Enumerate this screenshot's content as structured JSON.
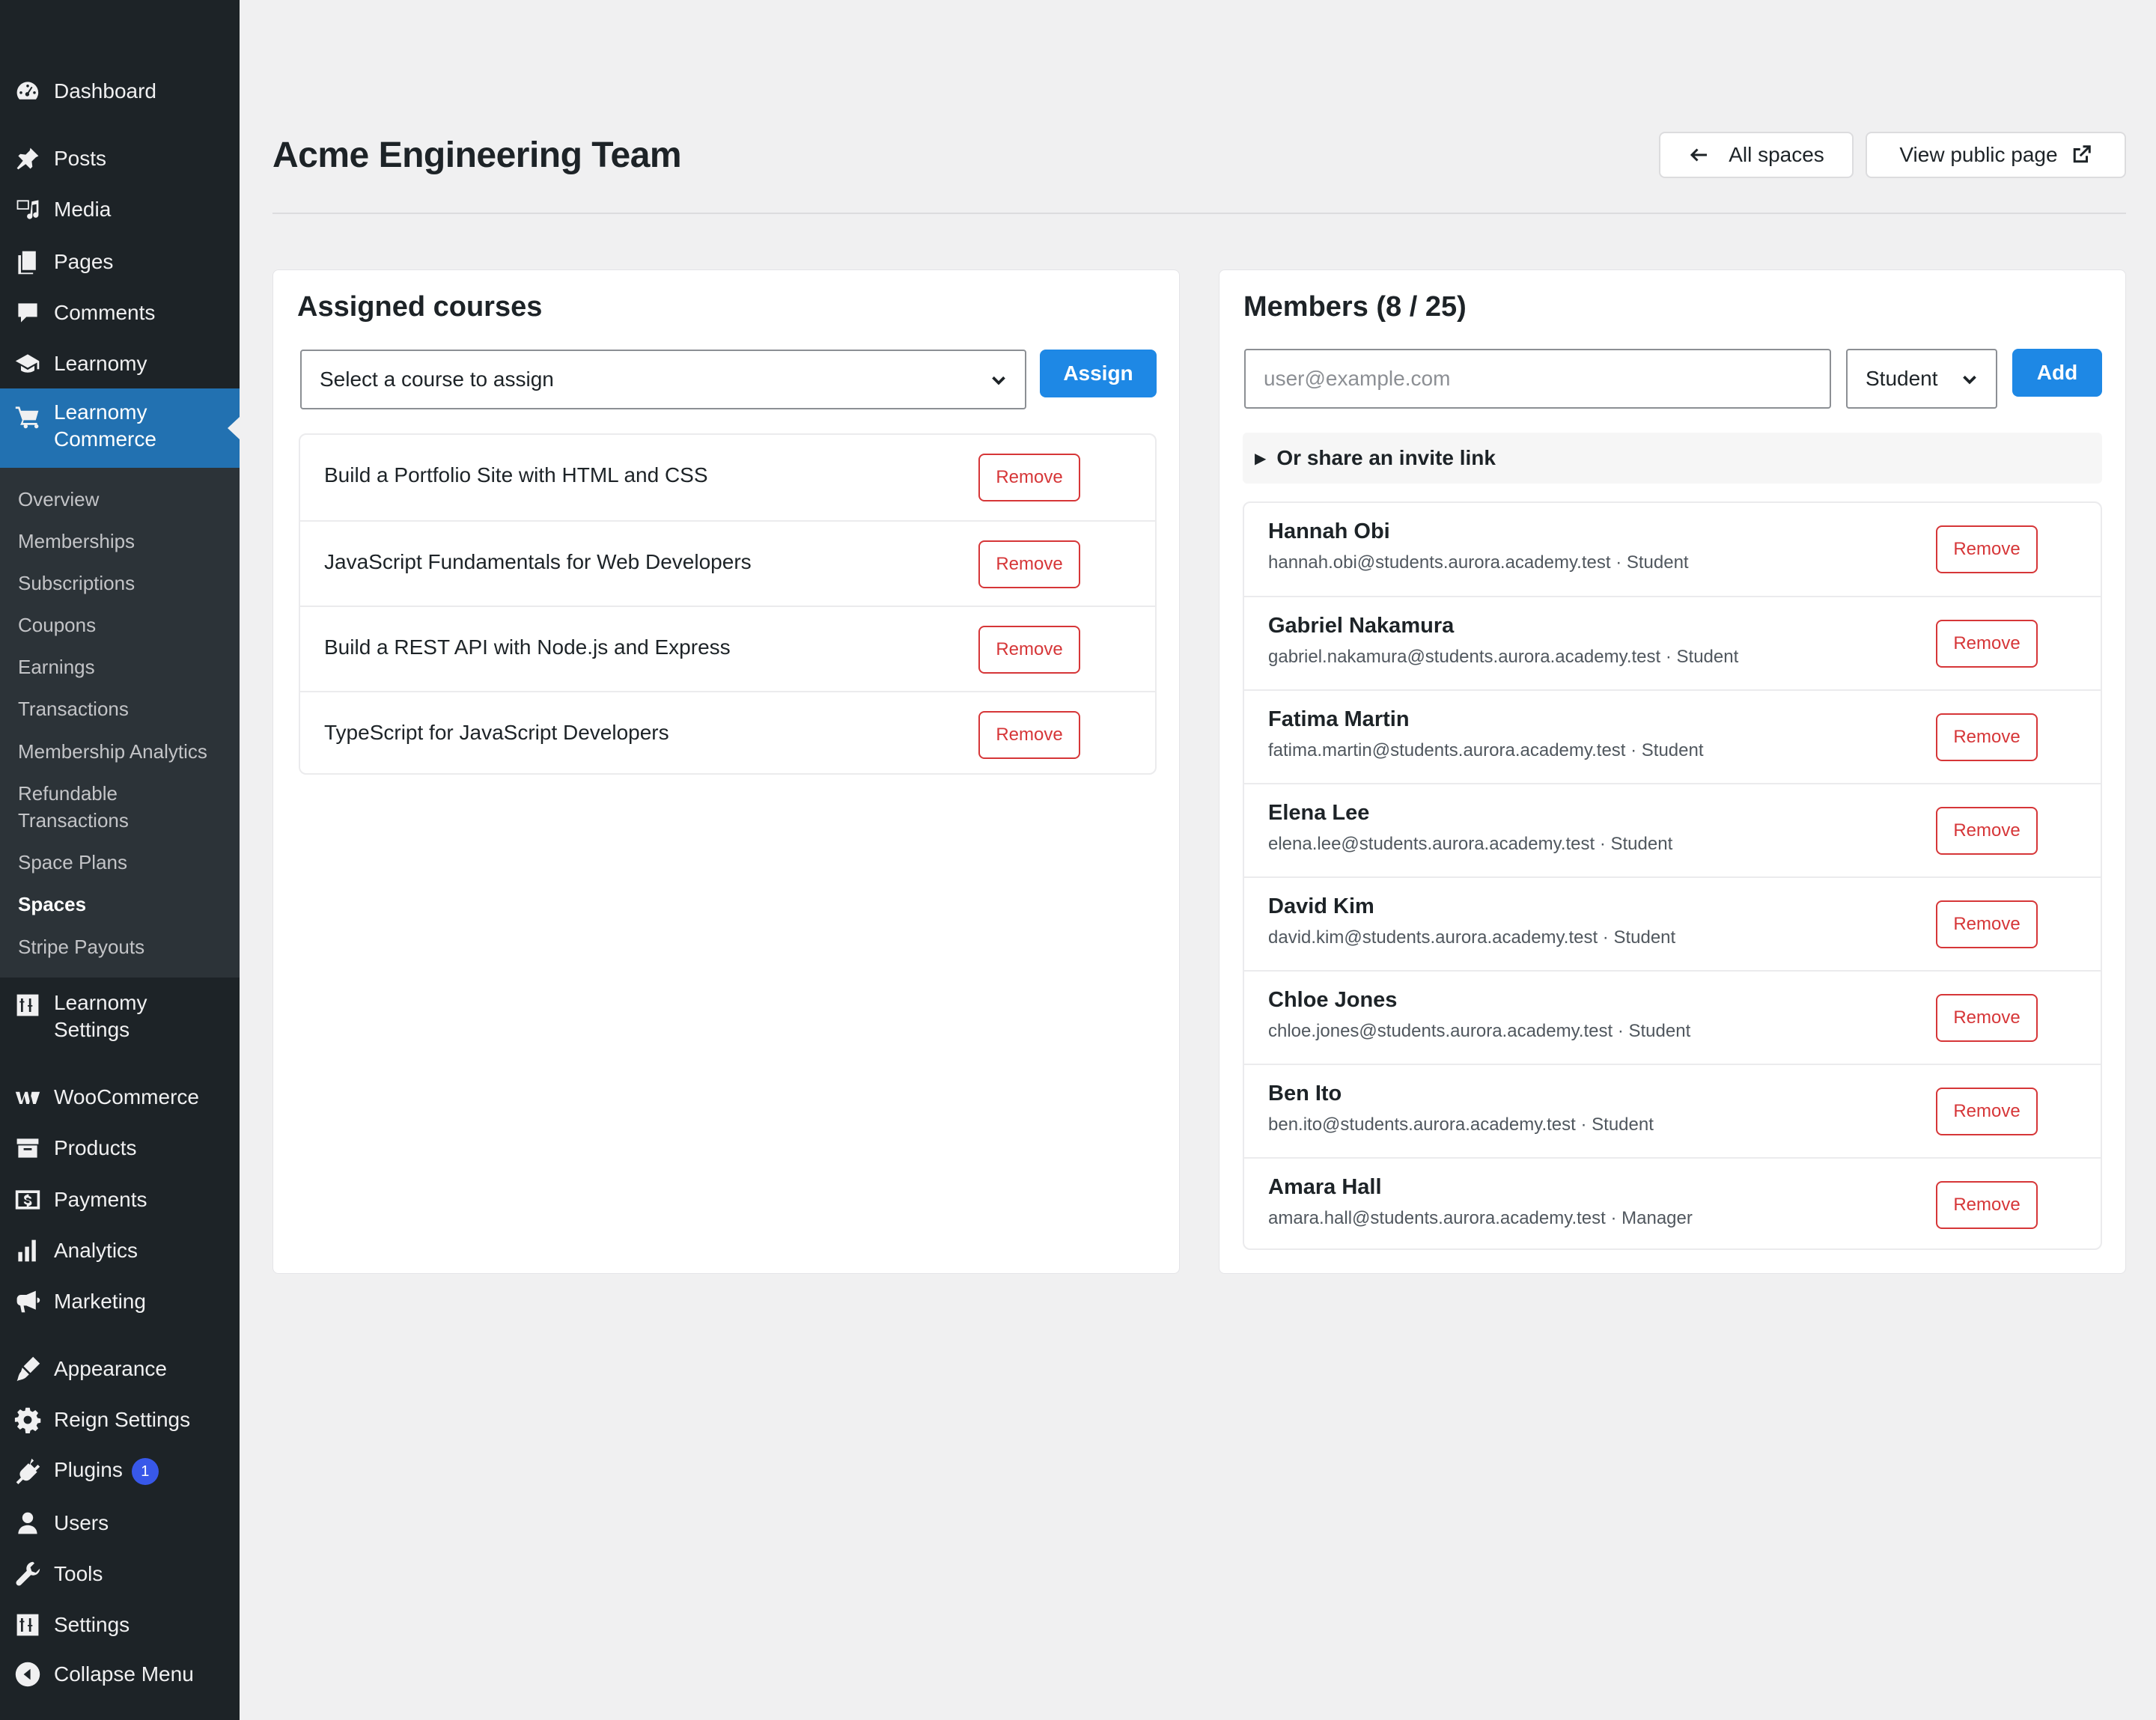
{
  "sidebar": {
    "top_items": [
      {
        "label": "Dashboard",
        "icon": "dashboard-icon"
      },
      {
        "label": "Posts",
        "icon": "pin-icon"
      },
      {
        "label": "Media",
        "icon": "media-icon"
      },
      {
        "label": "Pages",
        "icon": "pages-icon"
      },
      {
        "label": "Comments",
        "icon": "comment-icon"
      },
      {
        "label": "Learnomy",
        "icon": "graduation-cap-icon"
      }
    ],
    "active_item": {
      "label": "Learnomy Commerce",
      "line1": "Learnomy",
      "line2": "Commerce",
      "icon": "cart-icon"
    },
    "submenu": [
      "Overview",
      "Memberships",
      "Subscriptions",
      "Coupons",
      "Earnings",
      "Transactions",
      "Membership Analytics",
      "Refundable",
      "Transactions",
      "Space Plans",
      "Spaces",
      "Stripe Payouts"
    ],
    "submenu_current": "Spaces",
    "bottom_items": [
      {
        "line1": "Learnomy",
        "line2": "Settings",
        "icon": "settings-sliders-icon"
      },
      {
        "label": "WooCommerce",
        "icon": "woo-icon"
      },
      {
        "label": "Products",
        "icon": "archive-icon"
      },
      {
        "label": "Payments",
        "icon": "dollar-icon"
      },
      {
        "label": "Analytics",
        "icon": "bar-chart-icon"
      },
      {
        "label": "Marketing",
        "icon": "megaphone-icon"
      },
      {
        "label": "Appearance",
        "icon": "brush-icon"
      },
      {
        "label": "Reign Settings",
        "icon": "gear-icon"
      },
      {
        "label": "Plugins",
        "icon": "plugin-icon",
        "badge": "1"
      },
      {
        "label": "Users",
        "icon": "user-icon"
      },
      {
        "label": "Tools",
        "icon": "wrench-icon"
      },
      {
        "label": "Settings",
        "icon": "settings-sliders-icon"
      },
      {
        "label": "Collapse Menu",
        "icon": "collapse-icon"
      }
    ]
  },
  "header": {
    "title": "Acme Engineering Team",
    "all_spaces": "All spaces",
    "view_public": "View public page"
  },
  "courses_panel": {
    "title": "Assigned courses",
    "select_placeholder": "Select a course to assign",
    "assign_label": "Assign",
    "courses": [
      "Build a Portfolio Site with HTML and CSS",
      "JavaScript Fundamentals for Web Developers",
      "Build a REST API with Node.js and Express",
      "TypeScript for JavaScript Developers"
    ],
    "remove_label": "Remove"
  },
  "members_panel": {
    "title": "Members (8 / 25)",
    "email_placeholder": "user@example.com",
    "role_value": "Student",
    "add_label": "Add",
    "invite_label": "Or share an invite link",
    "remove_label": "Remove",
    "members": [
      {
        "name": "Hannah Obi",
        "meta": "hannah.obi@students.aurora.academy.test · Student"
      },
      {
        "name": "Gabriel Nakamura",
        "meta": "gabriel.nakamura@students.aurora.academy.test · Student"
      },
      {
        "name": "Fatima Martin",
        "meta": "fatima.martin@students.aurora.academy.test · Student"
      },
      {
        "name": "Elena Lee",
        "meta": "elena.lee@students.aurora.academy.test · Student"
      },
      {
        "name": "David Kim",
        "meta": "david.kim@students.aurora.academy.test · Student"
      },
      {
        "name": "Chloe Jones",
        "meta": "chloe.jones@students.aurora.academy.test · Student"
      },
      {
        "name": "Ben Ito",
        "meta": "ben.ito@students.aurora.academy.test · Student"
      },
      {
        "name": "Amara Hall",
        "meta": "amara.hall@students.aurora.academy.test · Manager"
      }
    ]
  },
  "colors": {
    "sidebar_bg": "#1d2327",
    "accent": "#2271b1",
    "primary_button": "#1e88e5",
    "danger": "#d63638"
  }
}
